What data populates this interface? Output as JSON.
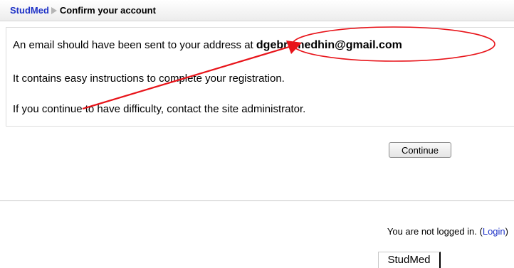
{
  "navbar": {
    "site_link": "StudMed",
    "separator_icon": "triangle-right-icon",
    "current_page": "Confirm your account"
  },
  "message": {
    "line1_prefix": "An email should have been sent to your address at ",
    "email": "dgebremedhin@gmail.com",
    "line2": "It contains easy instructions to complete your registration.",
    "line3": "If you continue to have difficulty, contact the site administrator."
  },
  "actions": {
    "continue_label": "Continue"
  },
  "footer": {
    "login_prefix": "You are not logged in. (",
    "login_link": "Login",
    "login_suffix": ")",
    "home_link": "StudMed"
  },
  "annotation": {
    "color": "#e8141a",
    "arrow_icon": "red-arrow",
    "highlight_shape": "red-ellipse"
  },
  "colors": {
    "link": "#1f33c7",
    "separator": "#b5b5b5",
    "annotation": "#e8141a"
  }
}
